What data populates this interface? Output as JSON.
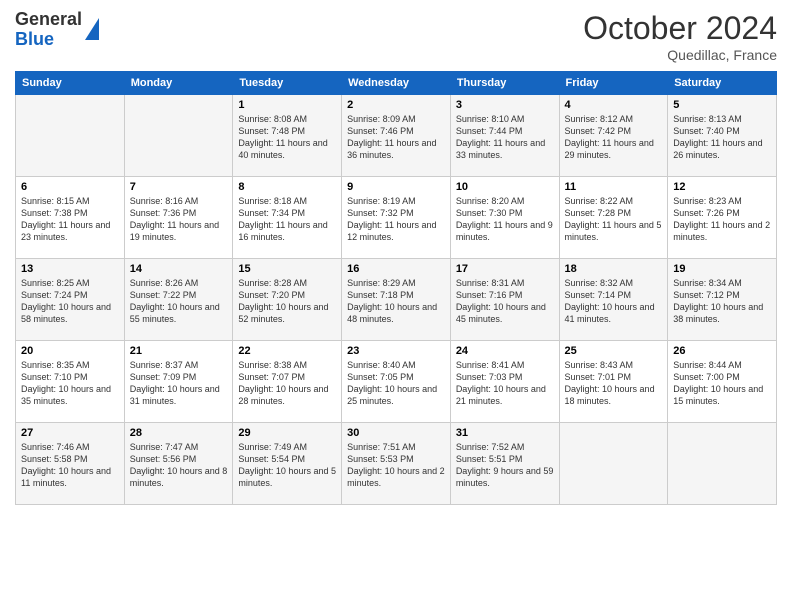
{
  "header": {
    "logo_general": "General",
    "logo_blue": "Blue",
    "month_title": "October 2024",
    "location": "Quedillac, France"
  },
  "days_of_week": [
    "Sunday",
    "Monday",
    "Tuesday",
    "Wednesday",
    "Thursday",
    "Friday",
    "Saturday"
  ],
  "weeks": [
    [
      {
        "day": "",
        "sunrise": "",
        "sunset": "",
        "daylight": ""
      },
      {
        "day": "",
        "sunrise": "",
        "sunset": "",
        "daylight": ""
      },
      {
        "day": "1",
        "sunrise": "Sunrise: 8:08 AM",
        "sunset": "Sunset: 7:48 PM",
        "daylight": "Daylight: 11 hours and 40 minutes."
      },
      {
        "day": "2",
        "sunrise": "Sunrise: 8:09 AM",
        "sunset": "Sunset: 7:46 PM",
        "daylight": "Daylight: 11 hours and 36 minutes."
      },
      {
        "day": "3",
        "sunrise": "Sunrise: 8:10 AM",
        "sunset": "Sunset: 7:44 PM",
        "daylight": "Daylight: 11 hours and 33 minutes."
      },
      {
        "day": "4",
        "sunrise": "Sunrise: 8:12 AM",
        "sunset": "Sunset: 7:42 PM",
        "daylight": "Daylight: 11 hours and 29 minutes."
      },
      {
        "day": "5",
        "sunrise": "Sunrise: 8:13 AM",
        "sunset": "Sunset: 7:40 PM",
        "daylight": "Daylight: 11 hours and 26 minutes."
      }
    ],
    [
      {
        "day": "6",
        "sunrise": "Sunrise: 8:15 AM",
        "sunset": "Sunset: 7:38 PM",
        "daylight": "Daylight: 11 hours and 23 minutes."
      },
      {
        "day": "7",
        "sunrise": "Sunrise: 8:16 AM",
        "sunset": "Sunset: 7:36 PM",
        "daylight": "Daylight: 11 hours and 19 minutes."
      },
      {
        "day": "8",
        "sunrise": "Sunrise: 8:18 AM",
        "sunset": "Sunset: 7:34 PM",
        "daylight": "Daylight: 11 hours and 16 minutes."
      },
      {
        "day": "9",
        "sunrise": "Sunrise: 8:19 AM",
        "sunset": "Sunset: 7:32 PM",
        "daylight": "Daylight: 11 hours and 12 minutes."
      },
      {
        "day": "10",
        "sunrise": "Sunrise: 8:20 AM",
        "sunset": "Sunset: 7:30 PM",
        "daylight": "Daylight: 11 hours and 9 minutes."
      },
      {
        "day": "11",
        "sunrise": "Sunrise: 8:22 AM",
        "sunset": "Sunset: 7:28 PM",
        "daylight": "Daylight: 11 hours and 5 minutes."
      },
      {
        "day": "12",
        "sunrise": "Sunrise: 8:23 AM",
        "sunset": "Sunset: 7:26 PM",
        "daylight": "Daylight: 11 hours and 2 minutes."
      }
    ],
    [
      {
        "day": "13",
        "sunrise": "Sunrise: 8:25 AM",
        "sunset": "Sunset: 7:24 PM",
        "daylight": "Daylight: 10 hours and 58 minutes."
      },
      {
        "day": "14",
        "sunrise": "Sunrise: 8:26 AM",
        "sunset": "Sunset: 7:22 PM",
        "daylight": "Daylight: 10 hours and 55 minutes."
      },
      {
        "day": "15",
        "sunrise": "Sunrise: 8:28 AM",
        "sunset": "Sunset: 7:20 PM",
        "daylight": "Daylight: 10 hours and 52 minutes."
      },
      {
        "day": "16",
        "sunrise": "Sunrise: 8:29 AM",
        "sunset": "Sunset: 7:18 PM",
        "daylight": "Daylight: 10 hours and 48 minutes."
      },
      {
        "day": "17",
        "sunrise": "Sunrise: 8:31 AM",
        "sunset": "Sunset: 7:16 PM",
        "daylight": "Daylight: 10 hours and 45 minutes."
      },
      {
        "day": "18",
        "sunrise": "Sunrise: 8:32 AM",
        "sunset": "Sunset: 7:14 PM",
        "daylight": "Daylight: 10 hours and 41 minutes."
      },
      {
        "day": "19",
        "sunrise": "Sunrise: 8:34 AM",
        "sunset": "Sunset: 7:12 PM",
        "daylight": "Daylight: 10 hours and 38 minutes."
      }
    ],
    [
      {
        "day": "20",
        "sunrise": "Sunrise: 8:35 AM",
        "sunset": "Sunset: 7:10 PM",
        "daylight": "Daylight: 10 hours and 35 minutes."
      },
      {
        "day": "21",
        "sunrise": "Sunrise: 8:37 AM",
        "sunset": "Sunset: 7:09 PM",
        "daylight": "Daylight: 10 hours and 31 minutes."
      },
      {
        "day": "22",
        "sunrise": "Sunrise: 8:38 AM",
        "sunset": "Sunset: 7:07 PM",
        "daylight": "Daylight: 10 hours and 28 minutes."
      },
      {
        "day": "23",
        "sunrise": "Sunrise: 8:40 AM",
        "sunset": "Sunset: 7:05 PM",
        "daylight": "Daylight: 10 hours and 25 minutes."
      },
      {
        "day": "24",
        "sunrise": "Sunrise: 8:41 AM",
        "sunset": "Sunset: 7:03 PM",
        "daylight": "Daylight: 10 hours and 21 minutes."
      },
      {
        "day": "25",
        "sunrise": "Sunrise: 8:43 AM",
        "sunset": "Sunset: 7:01 PM",
        "daylight": "Daylight: 10 hours and 18 minutes."
      },
      {
        "day": "26",
        "sunrise": "Sunrise: 8:44 AM",
        "sunset": "Sunset: 7:00 PM",
        "daylight": "Daylight: 10 hours and 15 minutes."
      }
    ],
    [
      {
        "day": "27",
        "sunrise": "Sunrise: 7:46 AM",
        "sunset": "Sunset: 5:58 PM",
        "daylight": "Daylight: 10 hours and 11 minutes."
      },
      {
        "day": "28",
        "sunrise": "Sunrise: 7:47 AM",
        "sunset": "Sunset: 5:56 PM",
        "daylight": "Daylight: 10 hours and 8 minutes."
      },
      {
        "day": "29",
        "sunrise": "Sunrise: 7:49 AM",
        "sunset": "Sunset: 5:54 PM",
        "daylight": "Daylight: 10 hours and 5 minutes."
      },
      {
        "day": "30",
        "sunrise": "Sunrise: 7:51 AM",
        "sunset": "Sunset: 5:53 PM",
        "daylight": "Daylight: 10 hours and 2 minutes."
      },
      {
        "day": "31",
        "sunrise": "Sunrise: 7:52 AM",
        "sunset": "Sunset: 5:51 PM",
        "daylight": "Daylight: 9 hours and 59 minutes."
      },
      {
        "day": "",
        "sunrise": "",
        "sunset": "",
        "daylight": ""
      },
      {
        "day": "",
        "sunrise": "",
        "sunset": "",
        "daylight": ""
      }
    ]
  ]
}
